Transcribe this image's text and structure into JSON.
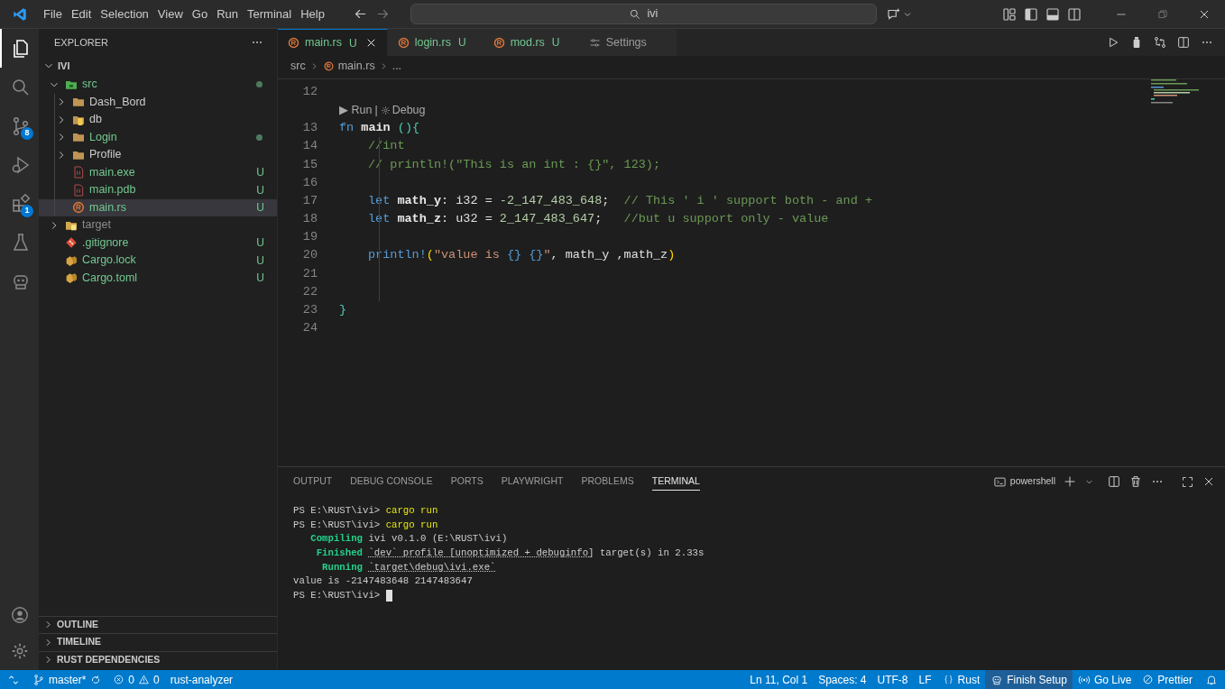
{
  "menu": [
    "File",
    "Edit",
    "Selection",
    "View",
    "Go",
    "Run",
    "Terminal",
    "Help"
  ],
  "search": {
    "value": "ivi"
  },
  "activity_bar": [
    {
      "selected": true
    },
    {
      "selected": false
    },
    {
      "selected": false,
      "badge": "8"
    },
    {
      "selected": false
    },
    {
      "selected": false,
      "badge": "1"
    },
    {
      "selected": false
    },
    {
      "selected": false
    }
  ],
  "explorer": {
    "title": "EXPLORER",
    "root": {
      "label": "IVI",
      "expanded": true,
      "children": [
        {
          "label": "src",
          "kind": "rustfolder",
          "expanded": true,
          "modified": true,
          "ignored": false,
          "selected": false,
          "children": [
            {
              "label": "Dash_Bord",
              "kind": "folder",
              "expanded": false,
              "modified": false,
              "ignored": false,
              "selected": false
            },
            {
              "label": "db",
              "kind": "dbfolder",
              "expanded": false,
              "modified": false,
              "ignored": false,
              "selected": false
            },
            {
              "label": "Login",
              "kind": "folder",
              "expanded": false,
              "modified": true,
              "ignored": false,
              "selected": false
            },
            {
              "label": "Profile",
              "kind": "folder",
              "expanded": false,
              "modified": false,
              "ignored": false,
              "selected": false
            },
            {
              "label": "main.exe",
              "kind": "binary",
              "modified": false,
              "ignored": false,
              "decoration": "U",
              "selected": false
            },
            {
              "label": "main.pdb",
              "kind": "binary",
              "modified": false,
              "ignored": false,
              "decoration": "U",
              "selected": false
            },
            {
              "label": "main.rs",
              "kind": "rust",
              "modified": false,
              "ignored": false,
              "decoration": "U",
              "selected": true
            }
          ]
        },
        {
          "label": "target",
          "kind": "targetfolder",
          "expanded": false,
          "modified": false,
          "ignored": true,
          "selected": false
        },
        {
          "label": ".gitignore",
          "kind": "git",
          "modified": false,
          "ignored": false,
          "decoration": "U",
          "selected": false
        },
        {
          "label": "Cargo.lock",
          "kind": "cargo",
          "modified": false,
          "ignored": false,
          "decoration": "U",
          "selected": false
        },
        {
          "label": "Cargo.toml",
          "kind": "cargo",
          "modified": false,
          "ignored": false,
          "decoration": "U",
          "selected": false
        }
      ]
    }
  },
  "sidebar_sections": [
    {
      "label": "OUTLINE",
      "expanded": false
    },
    {
      "label": "TIMELINE",
      "expanded": false
    },
    {
      "label": "RUST DEPENDENCIES",
      "expanded": false
    }
  ],
  "tabs": [
    {
      "label": "main.rs",
      "kind": "rust",
      "decoration": "U",
      "selected": true
    },
    {
      "label": "login.rs",
      "kind": "rust",
      "decoration": "U",
      "selected": false
    },
    {
      "label": "mod.rs",
      "kind": "rust",
      "decoration": "U",
      "selected": false
    },
    {
      "label": "Settings",
      "kind": "settings",
      "selected": false
    }
  ],
  "breadcrumb": [
    "src",
    "main.rs",
    "..."
  ],
  "editor": {
    "lines": [
      {
        "number": "12",
        "indented": false
      },
      {
        "kind": "codelens",
        "run": "▶ Run",
        "separator": "|",
        "debug": "Debug"
      },
      {
        "number": "13",
        "indented": false,
        "tokens": [
          {
            "kind": "kw",
            "text": "fn"
          },
          {
            "kind": "fn",
            "text": " main "
          },
          {
            "kind": "bracket",
            "text": "(){"
          }
        ]
      },
      {
        "number": "14",
        "indented": true,
        "tokens": [
          {
            "kind": "cmt",
            "text": "//int"
          }
        ]
      },
      {
        "number": "15",
        "indented": true,
        "tokens": [
          {
            "kind": "cmt",
            "text": "// println!(\"This is an int : {}\", 123);"
          }
        ]
      },
      {
        "number": "16",
        "indented": true
      },
      {
        "number": "17",
        "indented": true,
        "tokens": [
          {
            "kind": "kw",
            "text": "let"
          },
          {
            "kind": "var",
            "text": " math_y"
          },
          {
            "kind": "plain",
            "text": ": i32 = "
          },
          {
            "kind": "num",
            "text": "-2_147_483_648"
          },
          {
            "kind": "plain",
            "text": ";  "
          },
          {
            "kind": "cmt",
            "text": "// This ' i ' support both - and +"
          }
        ]
      },
      {
        "number": "18",
        "indented": true,
        "tokens": [
          {
            "kind": "kw",
            "text": "let"
          },
          {
            "kind": "var",
            "text": " math_z"
          },
          {
            "kind": "plain",
            "text": ": u32 = "
          },
          {
            "kind": "num",
            "text": "2_147_483_647"
          },
          {
            "kind": "plain",
            "text": ";   "
          },
          {
            "kind": "cmt",
            "text": "//but u support only - value"
          }
        ]
      },
      {
        "number": "19",
        "indented": true
      },
      {
        "number": "20",
        "indented": true,
        "tokens": [
          {
            "kind": "macro",
            "text": "println!"
          },
          {
            "kind": "paren",
            "text": "("
          },
          {
            "kind": "str",
            "text": "\"value is "
          },
          {
            "kind": "fmt",
            "text": "{} {}"
          },
          {
            "kind": "str",
            "text": "\""
          },
          {
            "kind": "plain",
            "text": ", math_y ,math_z"
          },
          {
            "kind": "paren",
            "text": ")"
          }
        ]
      },
      {
        "number": "21",
        "indented": true
      },
      {
        "number": "22",
        "indented": true
      },
      {
        "number": "23",
        "indented": false,
        "tokens": [
          {
            "kind": "bracket",
            "text": "}"
          }
        ]
      },
      {
        "number": "24",
        "indented": false
      }
    ]
  },
  "panel": {
    "tabs": [
      {
        "label": "OUTPUT",
        "selected": false
      },
      {
        "label": "DEBUG CONSOLE",
        "selected": false
      },
      {
        "label": "PORTS",
        "selected": false
      },
      {
        "label": "PLAYWRIGHT",
        "selected": false
      },
      {
        "label": "PROBLEMS",
        "selected": false
      },
      {
        "label": "TERMINAL",
        "selected": true
      }
    ],
    "shell": "powershell",
    "terminal": [
      [
        {
          "kind": "plain",
          "text": "PS E:\\RUST\\ivi> "
        },
        {
          "kind": "cmd",
          "text": "cargo run"
        }
      ],
      [
        {
          "kind": "plain",
          "text": "PS E:\\RUST\\ivi> "
        },
        {
          "kind": "cmd",
          "text": "cargo run"
        }
      ],
      [
        {
          "kind": "status",
          "text": "   Compiling"
        },
        {
          "kind": "plain",
          "text": " ivi v0.1.0 (E:\\RUST\\ivi)"
        }
      ],
      [
        {
          "kind": "status",
          "text": "    Finished "
        },
        {
          "kind": "link",
          "text": "`dev` profile [unoptimized + debuginfo]"
        },
        {
          "kind": "plain",
          "text": " target(s) in 2.33s"
        }
      ],
      [
        {
          "kind": "status",
          "text": "     Running "
        },
        {
          "kind": "link",
          "text": "`target\\debug\\ivi.exe`"
        }
      ],
      [
        {
          "kind": "plain",
          "text": "value is -2147483648 2147483647"
        }
      ],
      [
        {
          "kind": "plain",
          "text": "PS E:\\RUST\\ivi> "
        },
        {
          "kind": "cursor"
        }
      ]
    ]
  },
  "status_bar": {
    "left": [
      {
        "kind": "remote"
      },
      {
        "kind": "branch",
        "text": "master*"
      },
      {
        "kind": "problems",
        "errors": "0",
        "warnings": "0"
      },
      {
        "kind": "text",
        "text": "rust-analyzer"
      }
    ],
    "right": [
      {
        "kind": "text",
        "text": "Ln 11, Col 1"
      },
      {
        "kind": "text",
        "text": "Spaces: 4"
      },
      {
        "kind": "text",
        "text": "UTF-8"
      },
      {
        "kind": "text",
        "text": "LF"
      },
      {
        "kind": "language",
        "text": "Rust"
      },
      {
        "kind": "copilot",
        "text": "Finish Setup"
      },
      {
        "kind": "live",
        "text": "Go Live"
      },
      {
        "kind": "prettier",
        "text": "Prettier"
      },
      {
        "kind": "bell"
      }
    ]
  }
}
